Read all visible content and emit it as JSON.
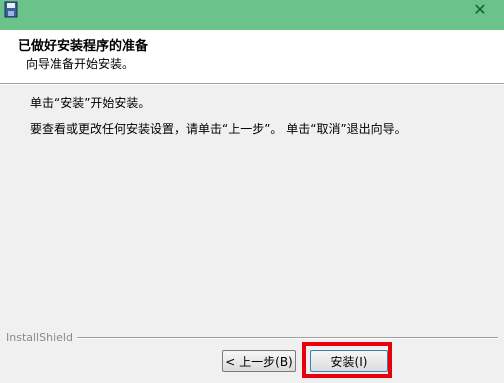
{
  "titlebar": {
    "app_icon": "installer-disk-icon",
    "close_glyph": "✕",
    "color": "#6bc389"
  },
  "header": {
    "title": "已做好安装程序的准备",
    "subtitle": "向导准备开始安装。"
  },
  "body": {
    "line1": "单击“安装”开始安装。",
    "line2": "要查看或更改任何安装设置，请单击“上一步”。 单击“取消”退出向导。"
  },
  "footer": {
    "brand": "InstallShield",
    "back_label": "< 上一步(B)",
    "install_label": "安装(I)",
    "highlight_color": "#e8000c"
  }
}
